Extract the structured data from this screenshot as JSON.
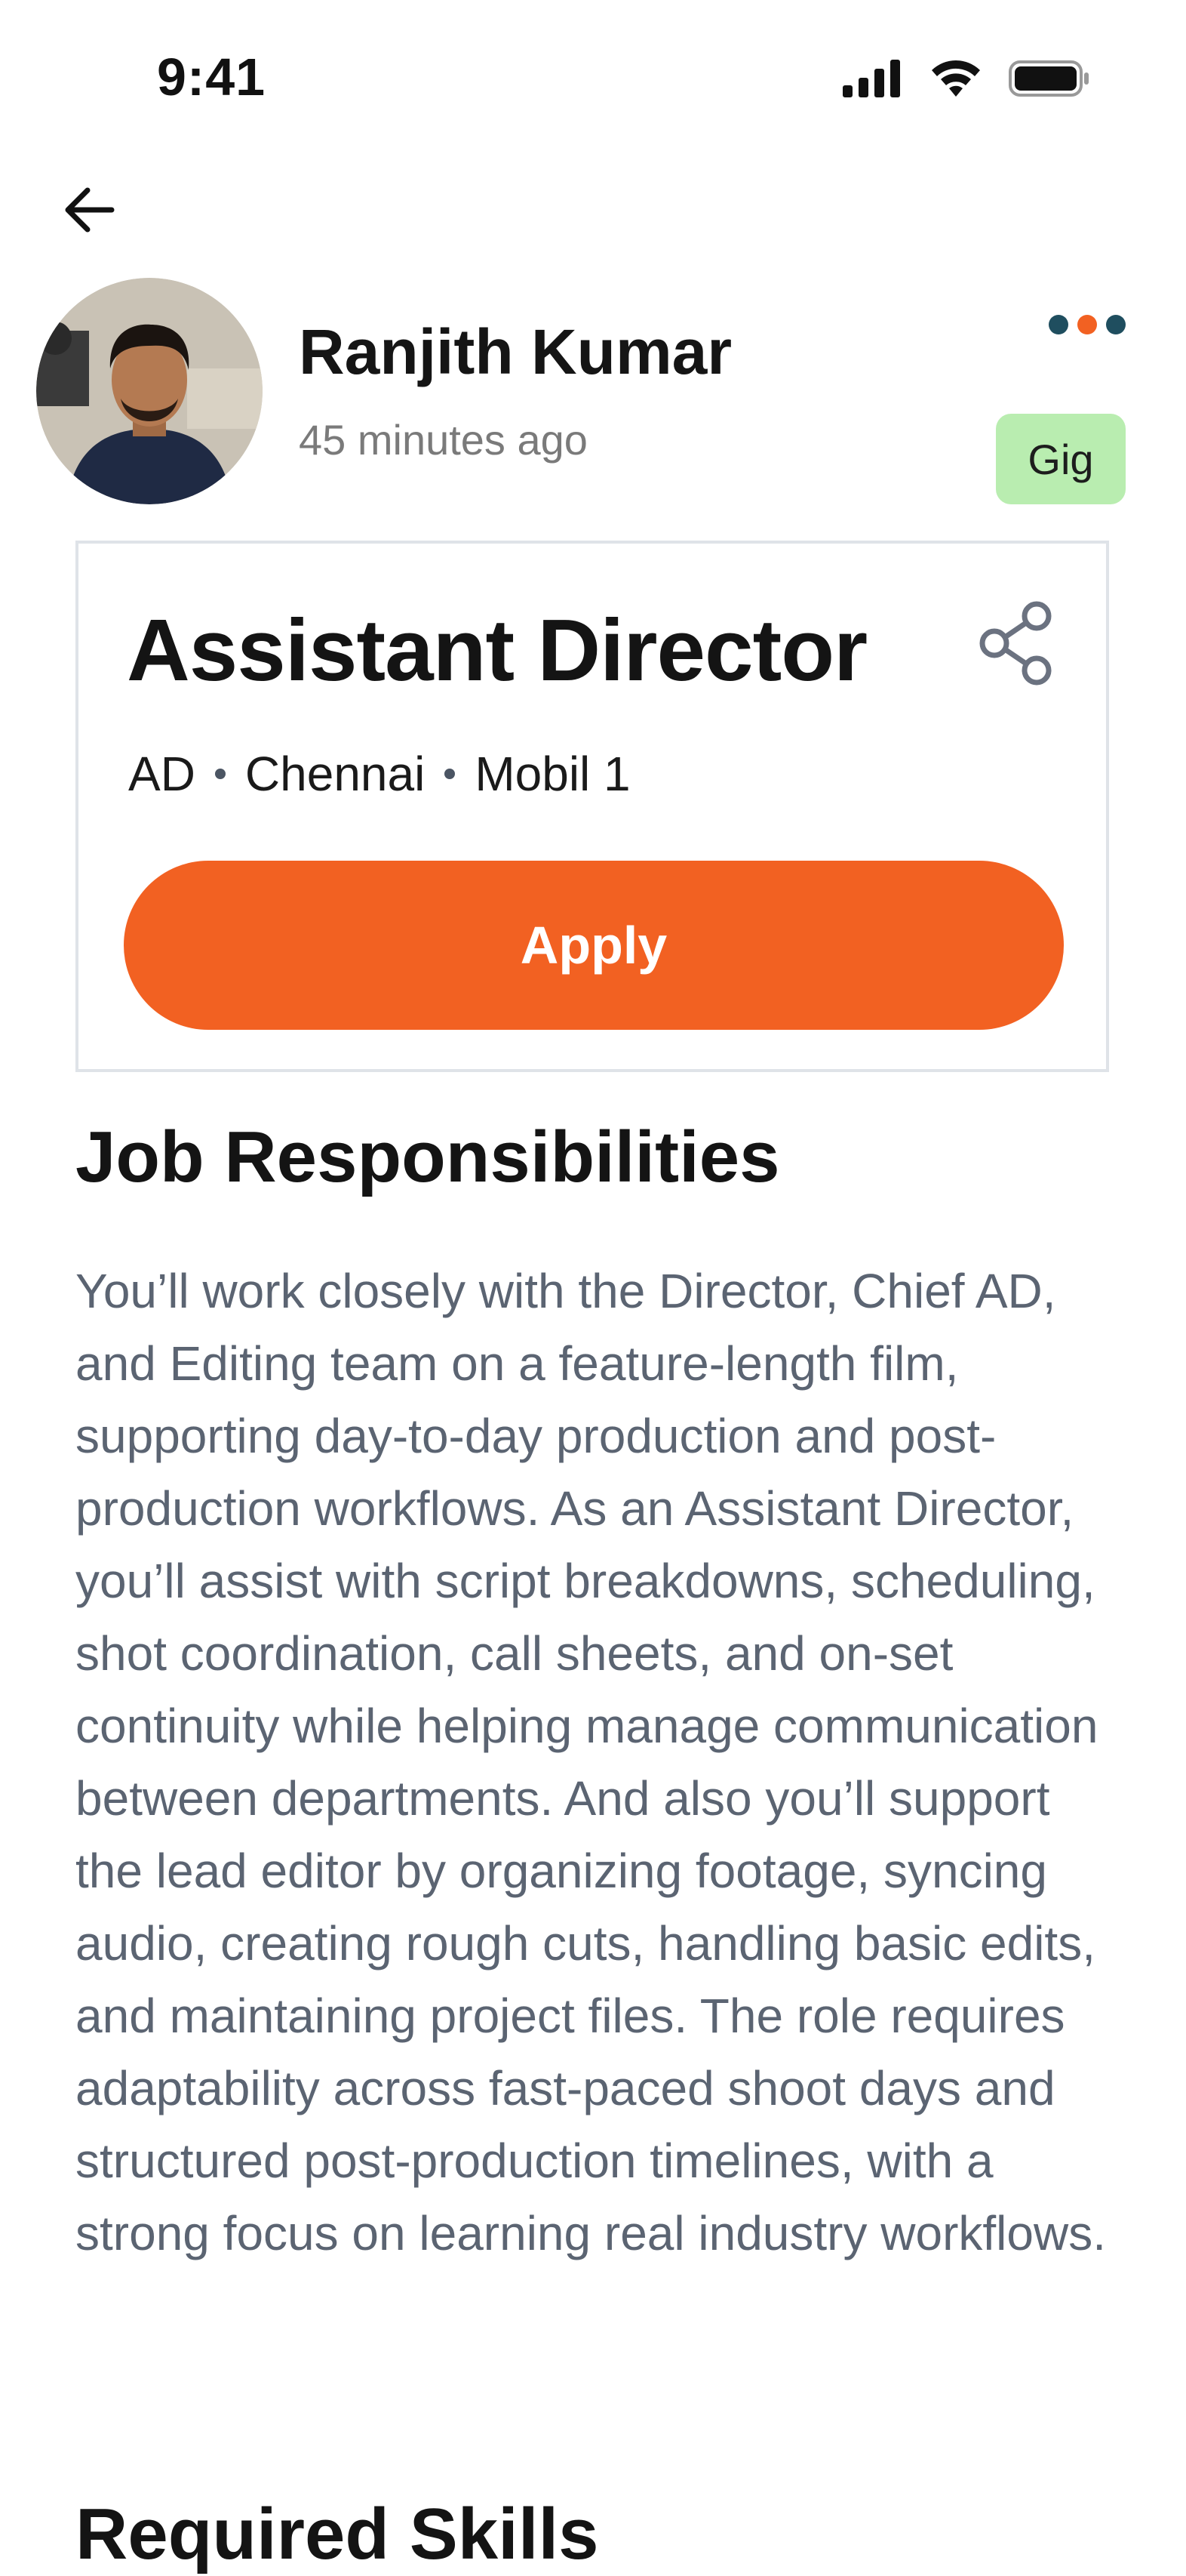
{
  "status_bar": {
    "time": "9:41",
    "icons": [
      "cellular-signal-icon",
      "wifi-icon",
      "battery-icon"
    ]
  },
  "nav": {
    "back_icon": "arrow-left-icon"
  },
  "author": {
    "name": "Ranjith Kumar",
    "posted": "45 minutes ago"
  },
  "post": {
    "menu_icon": "more-dots-icon",
    "menu_dot_colors": [
      "#1f4e5f",
      "#f26122",
      "#1f4e5f"
    ],
    "tag": "Gig"
  },
  "job": {
    "title": "Assistant Director",
    "share_icon": "share-icon",
    "meta": [
      "AD",
      "Chennai",
      "Mobil 1"
    ],
    "apply_label": "Apply"
  },
  "responsibilities": {
    "heading": "Job Responsibilities",
    "body": "You’ll work closely with the Director, Chief AD, and Editing team on a feature-length film, supporting day-to-day production and post-production workflows. As an Assistant Director, you’ll assist with script breakdowns, scheduling, shot coordination, call sheets, and on-set continuity while helping manage communication between departments. And also you’ll support the lead editor by organizing footage, syncing audio, creating rough cuts, handling basic edits, and maintaining project files. The role requires adaptability across fast-paced shoot days and structured post-production timelines, with a strong focus on learning real industry workflows."
  },
  "skills": {
    "heading": "Required Skills"
  },
  "colors": {
    "accent": "#f26122",
    "tag_bg": "#b9edb0",
    "body_text": "#5b6472"
  }
}
